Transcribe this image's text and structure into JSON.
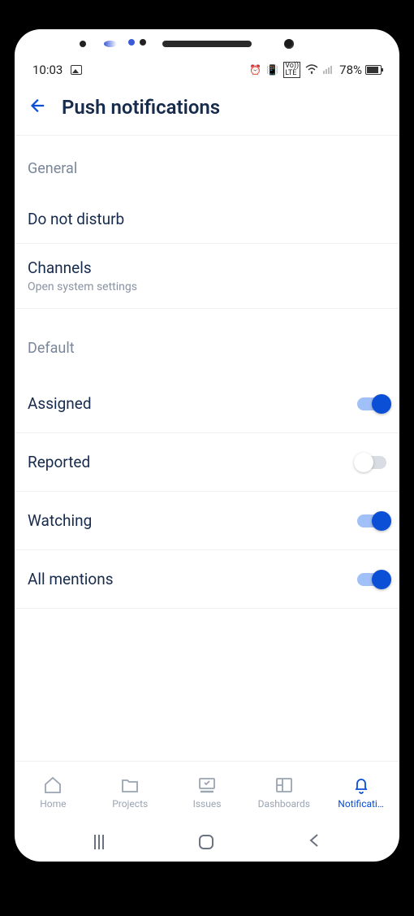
{
  "status_bar": {
    "time": "10:03",
    "battery_pct": "78%",
    "indicators": [
      "alarm",
      "vibrate",
      "volte",
      "wifi",
      "signal"
    ]
  },
  "header": {
    "title": "Push notifications"
  },
  "sections": {
    "general": {
      "label": "General",
      "do_not_disturb": "Do not disturb",
      "channels": {
        "title": "Channels",
        "subtitle": "Open system settings"
      }
    },
    "default": {
      "label": "Default",
      "items": [
        {
          "key": "assigned",
          "label": "Assigned",
          "on": true
        },
        {
          "key": "reported",
          "label": "Reported",
          "on": false
        },
        {
          "key": "watching",
          "label": "Watching",
          "on": true
        },
        {
          "key": "all_mentions",
          "label": "All mentions",
          "on": true
        }
      ]
    }
  },
  "bottom_nav": {
    "items": [
      {
        "key": "home",
        "label": "Home",
        "active": false
      },
      {
        "key": "projects",
        "label": "Projects",
        "active": false
      },
      {
        "key": "issues",
        "label": "Issues",
        "active": false
      },
      {
        "key": "dashboards",
        "label": "Dashboards",
        "active": false
      },
      {
        "key": "notifications",
        "label": "Notificati…",
        "active": true
      }
    ]
  }
}
